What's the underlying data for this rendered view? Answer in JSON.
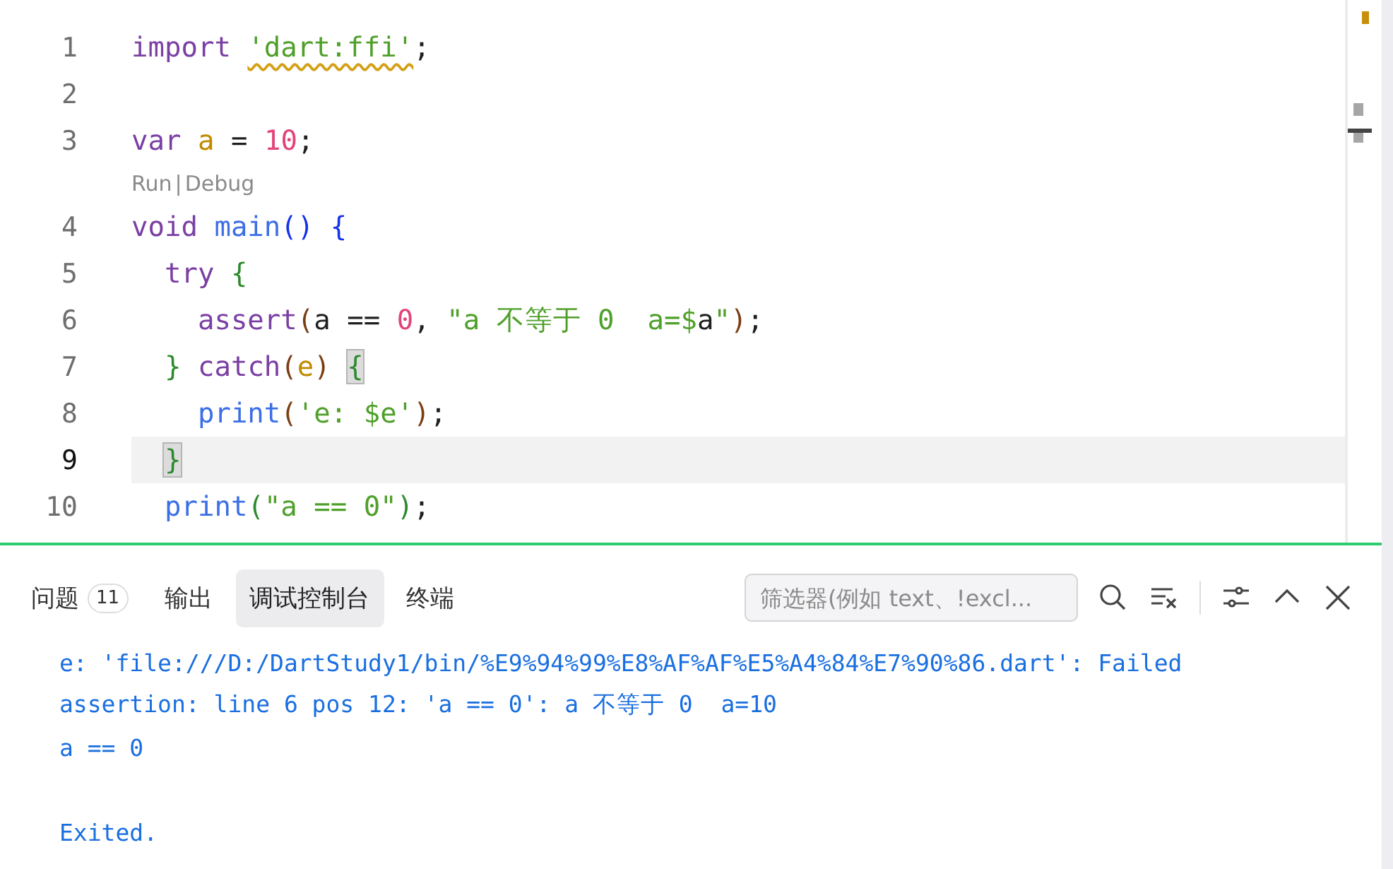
{
  "editor": {
    "lines": [
      {
        "number": "1",
        "current": false,
        "tokens": [
          {
            "kind": "keyword",
            "text": "import "
          },
          {
            "kind": "string",
            "text": "'dart:ffi'",
            "warning": true
          },
          {
            "kind": "plain",
            "text": ";"
          }
        ]
      },
      {
        "number": "2",
        "current": false
      },
      {
        "number": "3",
        "current": false,
        "tokens": [
          {
            "kind": "keyword",
            "text": "var "
          },
          {
            "kind": "variable",
            "text": "a"
          },
          {
            "kind": "plain",
            "text": " = "
          },
          {
            "kind": "number",
            "text": "10"
          },
          {
            "kind": "plain",
            "text": ";"
          }
        ]
      },
      {
        "number": "4",
        "current": false,
        "codelens": {
          "links": [
            "Run",
            "Debug"
          ],
          "separator": "|"
        },
        "tokens": [
          {
            "kind": "keyword",
            "text": "void "
          },
          {
            "kind": "function",
            "text": "main"
          },
          {
            "kind": "bracket1",
            "text": "() {"
          }
        ]
      },
      {
        "number": "5",
        "current": false,
        "tokens": [
          {
            "kind": "keyword",
            "text": "  try "
          },
          {
            "kind": "bracket2",
            "text": "{"
          }
        ]
      },
      {
        "number": "6",
        "current": false,
        "tokens": [
          {
            "kind": "keyword",
            "text": "    assert"
          },
          {
            "kind": "bracket3",
            "text": "("
          },
          {
            "kind": "plain",
            "text": "a == "
          },
          {
            "kind": "number",
            "text": "0"
          },
          {
            "kind": "plain",
            "text": ", "
          },
          {
            "kind": "string",
            "text": "\"a 不等于 0  a=$"
          },
          {
            "kind": "plain",
            "text": "a"
          },
          {
            "kind": "string",
            "text": "\""
          },
          {
            "kind": "bracket3",
            "text": ")"
          },
          {
            "kind": "plain",
            "text": ";"
          }
        ]
      },
      {
        "number": "7",
        "current": false,
        "tokens": [
          {
            "kind": "bracket2",
            "text": "  } "
          },
          {
            "kind": "keyword",
            "text": "catch"
          },
          {
            "kind": "bracket3",
            "text": "("
          },
          {
            "kind": "variable",
            "text": "e"
          },
          {
            "kind": "bracket3",
            "text": ") "
          },
          {
            "kind": "bracket2",
            "text": "{",
            "matched": true
          }
        ]
      },
      {
        "number": "8",
        "current": false,
        "tokens": [
          {
            "kind": "function",
            "text": "    print"
          },
          {
            "kind": "bracket3",
            "text": "("
          },
          {
            "kind": "string",
            "text": "'e: $e'"
          },
          {
            "kind": "bracket3",
            "text": ")"
          },
          {
            "kind": "plain",
            "text": ";"
          }
        ]
      },
      {
        "number": "9",
        "current": true,
        "tokens": [
          {
            "kind": "bracket2",
            "text": "  }",
            "matched": true
          }
        ]
      },
      {
        "number": "10",
        "current": false,
        "tokens": [
          {
            "kind": "function",
            "text": "  print"
          },
          {
            "kind": "bracket2",
            "text": "("
          },
          {
            "kind": "string",
            "text": "\"a == 0\""
          },
          {
            "kind": "bracket2",
            "text": ")"
          },
          {
            "kind": "plain",
            "text": ";"
          }
        ]
      }
    ]
  },
  "panel": {
    "tabs": [
      {
        "label": "问题",
        "badge": "11",
        "selected": false
      },
      {
        "label": "输出",
        "selected": false
      },
      {
        "label": "调试控制台",
        "selected": true
      },
      {
        "label": "终端",
        "selected": false
      }
    ],
    "filter": {
      "placeholder": "筛选器(例如 text、!excl..."
    },
    "output": [
      "e: 'file:///D:/DartStudy1/bin/%E9%94%99%E8%AF%AF%E5%A4%84%E7%90%86.dart': Failed",
      "assertion: line 6 pos 12: 'a == 0': a 不等于 0  a=10",
      "a == 0"
    ],
    "exit_message": "Exited."
  }
}
